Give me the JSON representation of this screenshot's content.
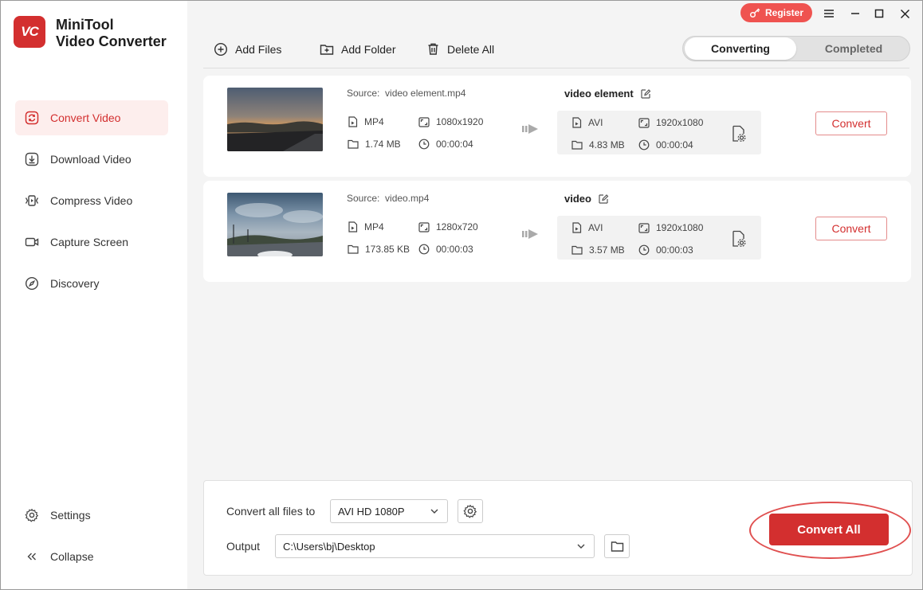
{
  "app": {
    "title_line1": "MiniTool",
    "title_line2": "Video Converter",
    "logo_text": "VC",
    "brand_color": "#d32f2f"
  },
  "sidebar": {
    "items": [
      {
        "label": "Convert Video",
        "icon": "convert-video-icon",
        "active": true
      },
      {
        "label": "Download Video",
        "icon": "download-icon",
        "active": false
      },
      {
        "label": "Compress Video",
        "icon": "compress-icon",
        "active": false
      },
      {
        "label": "Capture Screen",
        "icon": "camera-icon",
        "active": false
      },
      {
        "label": "Discovery",
        "icon": "compass-icon",
        "active": false
      }
    ],
    "settings_label": "Settings",
    "collapse_label": "Collapse"
  },
  "titlebar": {
    "register_label": "Register"
  },
  "toolbar": {
    "add_files": "Add Files",
    "add_folder": "Add Folder",
    "delete_all": "Delete All"
  },
  "tabs": {
    "converting": "Converting",
    "completed": "Completed"
  },
  "tasks": [
    {
      "source_prefix": "Source:",
      "source_name": "video element.mp4",
      "src_format": "MP4",
      "src_resolution": "1080x1920",
      "src_size": "1.74 MB",
      "src_duration": "00:00:04",
      "target_name": "video element",
      "dst_format": "AVI",
      "dst_resolution": "1920x1080",
      "dst_size": "4.83 MB",
      "dst_duration": "00:00:04",
      "convert_label": "Convert"
    },
    {
      "source_prefix": "Source:",
      "source_name": "video.mp4",
      "src_format": "MP4",
      "src_resolution": "1280x720",
      "src_size": "173.85 KB",
      "src_duration": "00:00:03",
      "target_name": "video",
      "dst_format": "AVI",
      "dst_resolution": "1920x1080",
      "dst_size": "3.57 MB",
      "dst_duration": "00:00:03",
      "convert_label": "Convert"
    }
  ],
  "bottom": {
    "convert_all_files_to_label": "Convert all files to",
    "format_value": "AVI HD 1080P",
    "output_label": "Output",
    "output_path": "C:\\Users\\bj\\Desktop",
    "convert_all_label": "Convert All"
  }
}
